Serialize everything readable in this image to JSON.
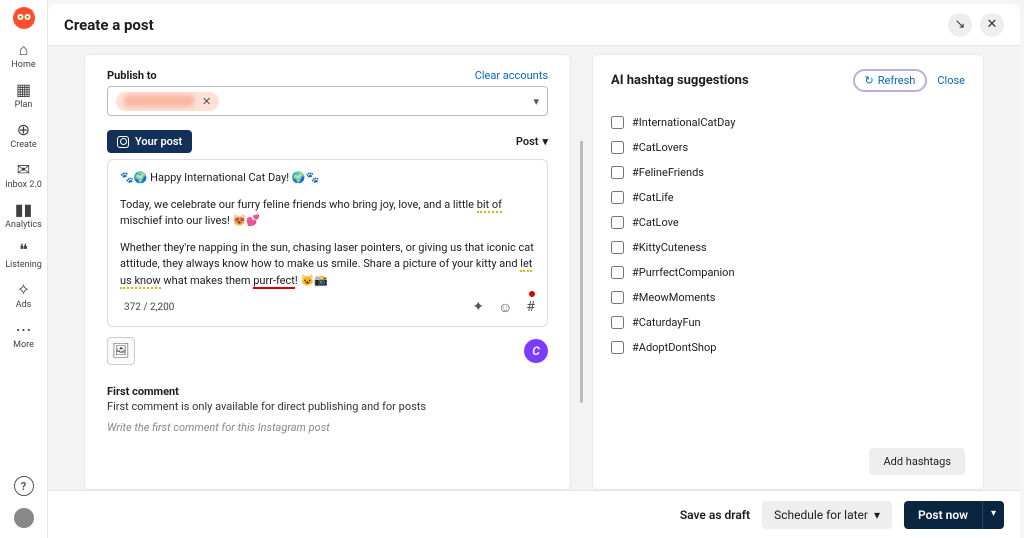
{
  "title": "Create a post",
  "sidebar": {
    "items": [
      {
        "label": "Home"
      },
      {
        "label": "Plan"
      },
      {
        "label": "Create"
      },
      {
        "label": "Inbox 2.0"
      },
      {
        "label": "Analytics"
      },
      {
        "label": "Listening"
      },
      {
        "label": "Ads"
      },
      {
        "label": "More"
      }
    ]
  },
  "publish": {
    "label": "Publish to",
    "clear": "Clear accounts"
  },
  "your_post": "Your post",
  "post_type": "Post",
  "editor": {
    "line1_prefix": "🐾🌍 Happy International Cat Day! 🌍🐾",
    "line2a": "Today, we celebrate our furry feline friends who bring joy, love, and a little ",
    "line2b": "bit of",
    "line2c": " mischief into our lives! 😻💕",
    "line3a": "Whether they're napping in the sun, chasing laser pointers, or giving us that iconic cat attitude, they always know how to make us smile. Share a picture of your kitty and ",
    "line3b": "let us know",
    "line3c": " what makes them ",
    "line3d": "purr-fect",
    "line3e": "! 😺📸",
    "count": "372 / 2,200"
  },
  "first_comment": {
    "label": "First comment",
    "desc": "First comment is only available for direct publishing and for posts",
    "placeholder": "Write the first comment for this Instagram post"
  },
  "hashtags": {
    "title": "AI hashtag suggestions",
    "refresh": "Refresh",
    "close": "Close",
    "add": "Add hashtags",
    "items": [
      "#InternationalCatDay",
      "#CatLovers",
      "#FelineFriends",
      "#CatLife",
      "#CatLove",
      "#KittyCuteness",
      "#PurrfectCompanion",
      "#MeowMoments",
      "#CaturdayFun",
      "#AdoptDontShop"
    ]
  },
  "footer": {
    "draft": "Save as draft",
    "schedule": "Schedule for later",
    "post": "Post now"
  }
}
